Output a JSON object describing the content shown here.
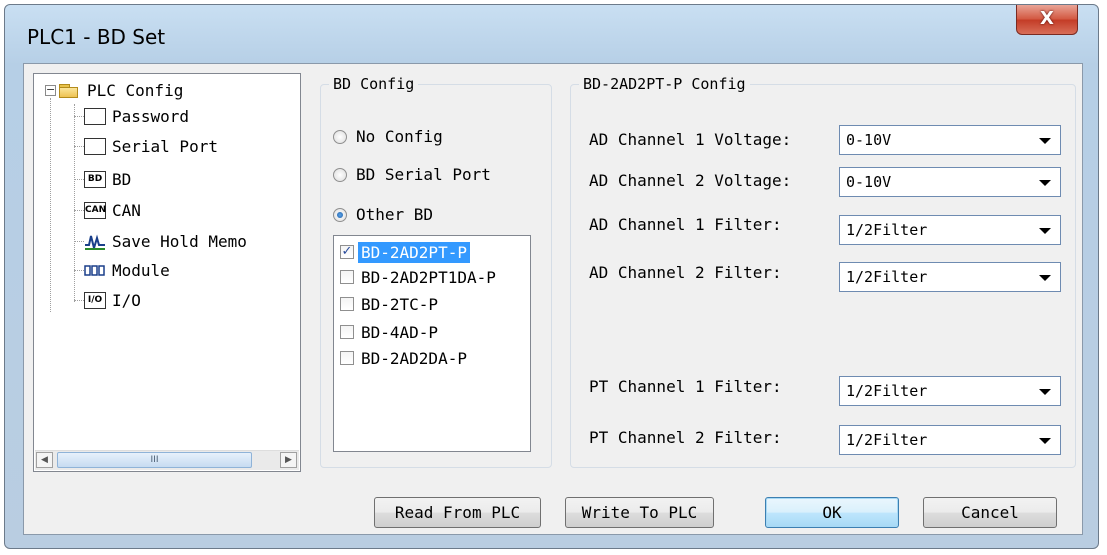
{
  "window": {
    "title": "PLC1 - BD Set",
    "close_label": "X"
  },
  "tree": {
    "root_label": "PLC Config",
    "expander": "−",
    "items": [
      {
        "label": "Password",
        "icon_name": "password-icon",
        "icon_text": ""
      },
      {
        "label": "Serial Port",
        "icon_name": "serial-port-icon",
        "icon_text": ""
      },
      {
        "label": "BD",
        "icon_name": "bd-icon",
        "icon_text": "BD"
      },
      {
        "label": "CAN",
        "icon_name": "can-icon",
        "icon_text": "CAN"
      },
      {
        "label": "Save Hold Memo",
        "icon_name": "save-hold-memory-icon",
        "icon_text": ""
      },
      {
        "label": "Module",
        "icon_name": "module-icon",
        "icon_text": ""
      },
      {
        "label": "I/O",
        "icon_name": "io-icon",
        "icon_text": "I/O"
      }
    ],
    "scroll_left": "◀",
    "scroll_right": "▶",
    "scroll_grip": "III"
  },
  "bd_config": {
    "title": "BD Config",
    "options": [
      {
        "label": "No Config",
        "selected": false
      },
      {
        "label": "BD Serial Port",
        "selected": false
      },
      {
        "label": "Other BD",
        "selected": true
      }
    ],
    "list": [
      {
        "label": "BD-2AD2PT-P",
        "checked": true,
        "mark": "✓"
      },
      {
        "label": "BD-2AD2PT1DA-P",
        "checked": false,
        "mark": ""
      },
      {
        "label": "BD-2TC-P",
        "checked": false,
        "mark": ""
      },
      {
        "label": "BD-4AD-P",
        "checked": false,
        "mark": ""
      },
      {
        "label": "BD-2AD2DA-P",
        "checked": false,
        "mark": ""
      }
    ]
  },
  "module_config": {
    "title": "BD-2AD2PT-P Config",
    "fields": [
      {
        "label": "AD Channel 1 Voltage:",
        "value": "0-10V"
      },
      {
        "label": "AD Channel 2 Voltage:",
        "value": "0-10V"
      },
      {
        "label": "AD Channel 1 Filter:",
        "value": "1/2Filter"
      },
      {
        "label": "AD Channel 2 Filter:",
        "value": "1/2Filter"
      },
      {
        "label": "PT Channel 1 Filter:",
        "value": "1/2Filter"
      },
      {
        "label": "PT Channel 2 Filter:",
        "value": "1/2Filter"
      }
    ]
  },
  "buttons": {
    "read": "Read From PLC",
    "write": "Write To PLC",
    "ok": "OK",
    "cancel": "Cancel"
  },
  "colors": {
    "selection": "#3399ff",
    "title_bar": "#c9dff2",
    "close_button": "#d2563f"
  }
}
